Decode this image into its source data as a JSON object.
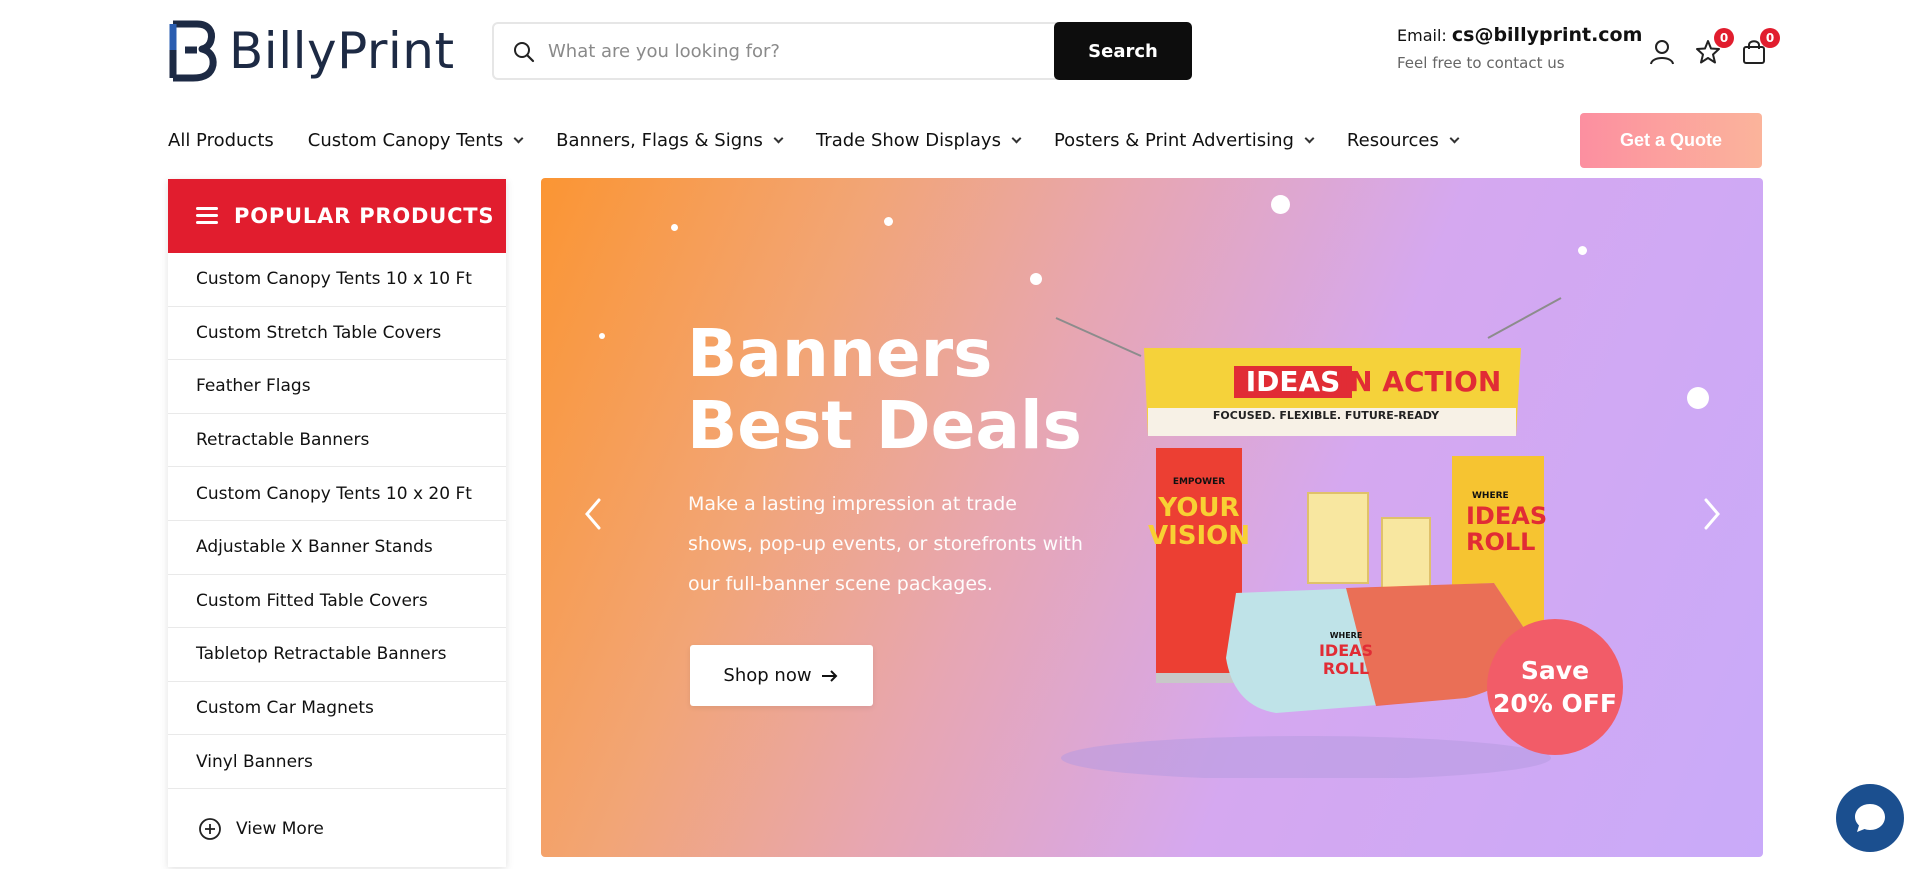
{
  "brand": {
    "name": "BillyPrint"
  },
  "search": {
    "placeholder": "What are you looking for?",
    "button_label": "Search"
  },
  "contact": {
    "email_label": "Email:",
    "email": "cs@billyprint.com",
    "subtitle": "Feel free to contact us"
  },
  "header_icons": {
    "account": "user-icon",
    "wishlist": "star-icon",
    "cart": "bag-icon",
    "wishlist_count": "0",
    "cart_count": "0"
  },
  "nav": {
    "items": [
      {
        "label": "All Products"
      },
      {
        "label": "Custom Canopy Tents"
      },
      {
        "label": "Banners, Flags & Signs"
      },
      {
        "label": "Trade Show Displays"
      },
      {
        "label": "Posters & Print Advertising"
      },
      {
        "label": "Resources"
      }
    ],
    "quote_label": "Get a Quote"
  },
  "sidebar": {
    "title": "POPULAR PRODUCTS",
    "items": [
      {
        "label": "Custom Canopy Tents 10 x 10 Ft"
      },
      {
        "label": "Custom Stretch Table Covers"
      },
      {
        "label": "Feather Flags"
      },
      {
        "label": "Retractable Banners"
      },
      {
        "label": "Custom Canopy Tents 10 x 20 Ft"
      },
      {
        "label": "Adjustable X Banner Stands"
      },
      {
        "label": "Custom Fitted Table Covers"
      },
      {
        "label": "Tabletop Retractable Banners"
      },
      {
        "label": "Custom Car Magnets"
      },
      {
        "label": "Vinyl Banners"
      }
    ],
    "view_more": "View More"
  },
  "hero": {
    "title_line1": "Banners",
    "title_line2": "Best Deals",
    "description": "Make a lasting impression at trade shows, pop-up events, or storefronts with our full-banner scene packages.",
    "button_label": "Shop now",
    "save_line1": "Save",
    "save_line2": "20% OFF",
    "banner": {
      "ideas": "IDEAS",
      "in_action": "IN ACTION",
      "tagline": "FOCUSED. FLEXIBLE. FUTURE-READY"
    },
    "stand_left": {
      "top": "EMPOWER",
      "main1": "YOUR",
      "main2": "VISION"
    },
    "stand_right": {
      "top": "WHERE",
      "main1": "IDEAS",
      "main2": "ROLL"
    },
    "table_text": {
      "top": "WHERE",
      "main1": "IDEAS",
      "main2": "ROLL"
    }
  },
  "colors": {
    "accent_red": "#e11d2e",
    "quote_gradient_start": "#fc8fa0",
    "quote_gradient_end": "#fbb49b",
    "chat_blue": "#1b4f8f",
    "save_badge": "#f25c68"
  },
  "chat": {
    "icon": "chat-bubble-icon"
  }
}
